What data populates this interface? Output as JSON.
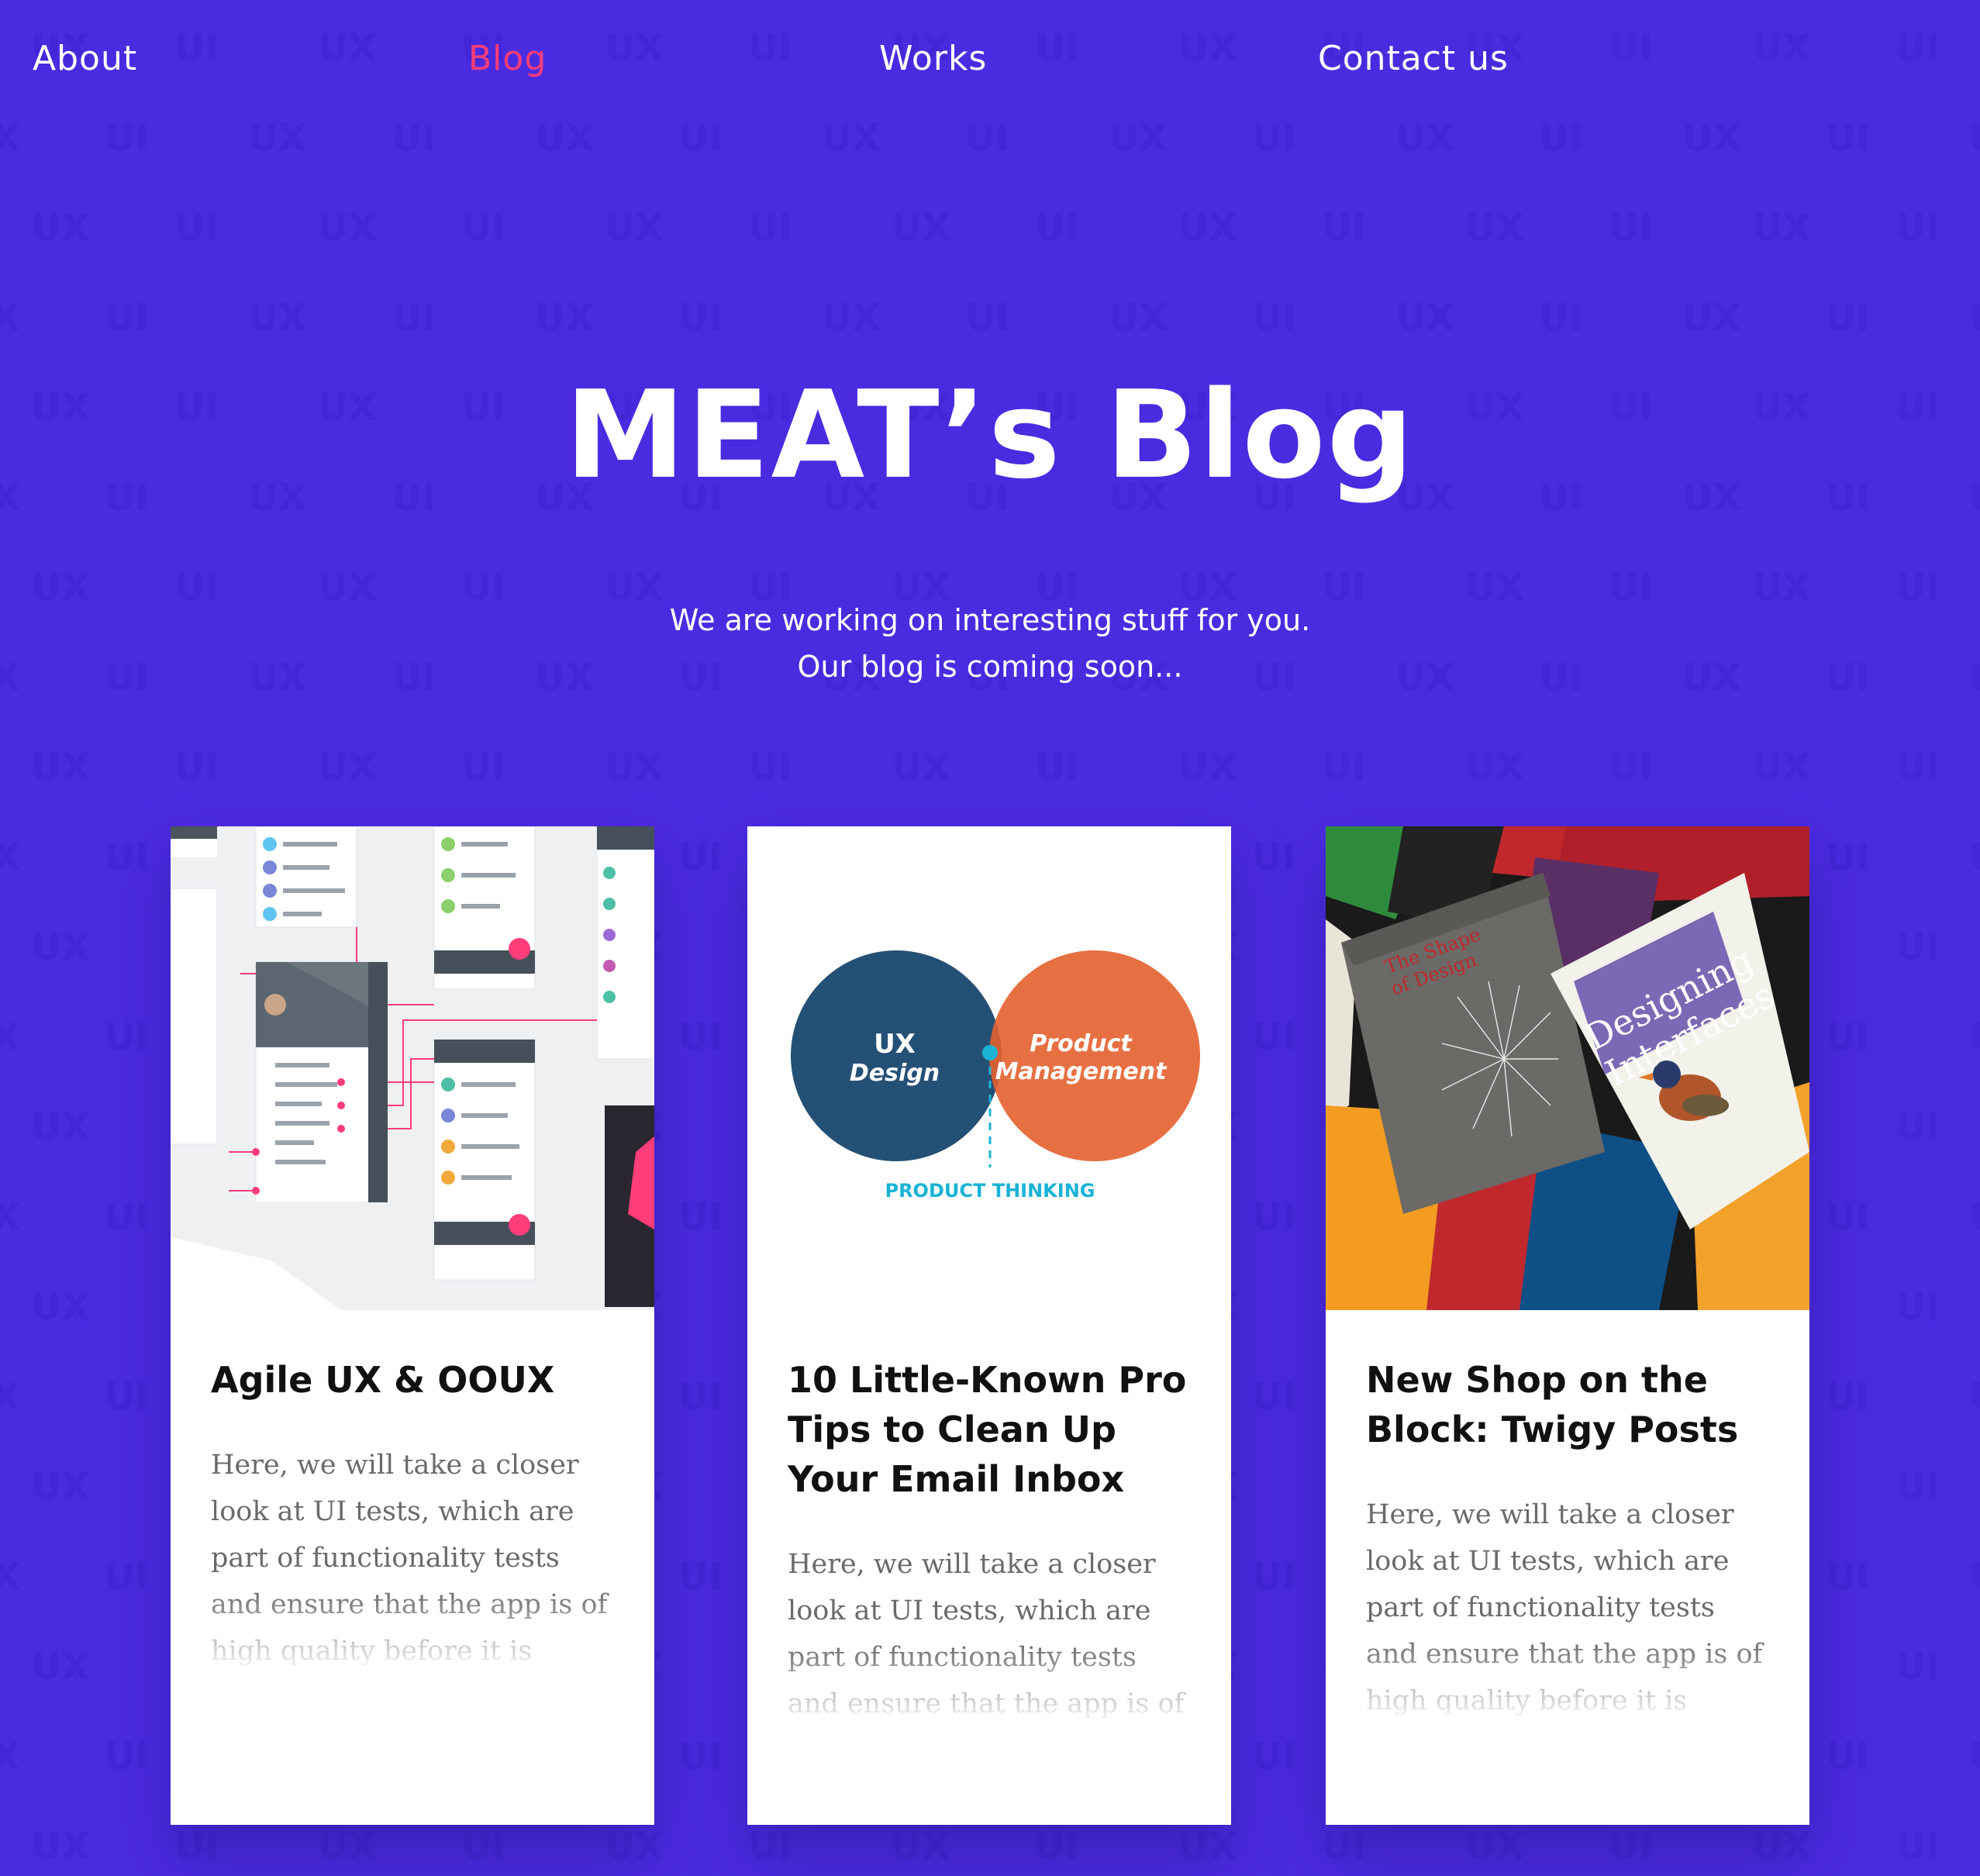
{
  "colors": {
    "background": "#4b2be0",
    "pattern": "#4326d6",
    "text": "#ffffff",
    "accent": "#ff3d78",
    "card": "#ffffff"
  },
  "pattern": {
    "words": [
      "UX",
      "UI"
    ]
  },
  "nav": {
    "items": [
      {
        "label": "About",
        "active": false
      },
      {
        "label": "Blog",
        "active": true
      },
      {
        "label": "Works",
        "active": false
      },
      {
        "label": "Contact us",
        "active": false
      }
    ]
  },
  "hero": {
    "title": "MEAT’s Blog",
    "subtitle_line1": "We are working on interesting stuff for you.",
    "subtitle_line2": "Our blog is coming soon..."
  },
  "cards": [
    {
      "title": "Agile UX & OOUX",
      "excerpt": "Here, we will take a closer look at UI tests, which are part of functionality tests and ensure that the app is of high quality before it is released on the market. These tests help",
      "image": "app-wireframe-screens"
    },
    {
      "title": "10 Little-Known Pro Tips to Clean Up Your Email Inbox",
      "excerpt": "Here, we will take a closer look at UI tests, which are part of functionality tests and ensure that the app is of high",
      "image": "venn-diagram",
      "venn": {
        "left_line1": "UX",
        "left_line2": "Design",
        "right_line1": "Product",
        "right_line2": "Management",
        "caption": "PRODUCT THINKING"
      }
    },
    {
      "title": "New Shop on the Block: Twigy Posts",
      "excerpt": "Here, we will take a closer look at UI tests, which are part of functionality tests and ensure that the app is of high quality before it is released on",
      "image": "design-books-photo",
      "books": {
        "book1_line1": "The Shape",
        "book1_line2": "of Design",
        "book2_line1": "Designing",
        "book2_line2": "Interfaces"
      }
    }
  ]
}
